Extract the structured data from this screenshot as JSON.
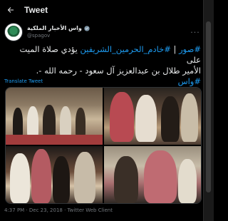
{
  "header": {
    "title": "Tweet"
  },
  "author": {
    "display_name": "واس الأخبار الملكية",
    "handle": "@spagov"
  },
  "tweet": {
    "line1_hashtag_a": "#صور",
    "line1_sep": " | ",
    "line1_hashtag_b": "#خادم_الحرمين_الشريفين",
    "line1_text": " يؤدي صلاة الميت على",
    "line2_text": "الأمير طلال بن عبدالعزيز آل سعود - رحمه الله -.",
    "line3_hashtag": "#واس",
    "translate_label": "Translate Tweet"
  },
  "meta": {
    "time": "4:37 PM",
    "date": "Dec 23, 2018",
    "client": "Twitter Web Client",
    "separator": " · "
  },
  "colors": {
    "accent": "#1d9bf0",
    "background": "#000000",
    "text": "#e7e9ea",
    "muted": "#71767b"
  },
  "icons": {
    "back": "arrow-left-icon",
    "verified": "verified-badge-icon",
    "more": "more-icon"
  }
}
